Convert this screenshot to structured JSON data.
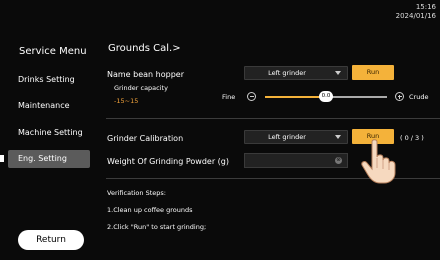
{
  "status": {
    "time": "15:16",
    "date": "2024/01/16"
  },
  "sidebar": {
    "title": "Service Menu",
    "items": [
      {
        "label": "Drinks Setting",
        "active": false
      },
      {
        "label": "Maintenance",
        "active": false
      },
      {
        "label": "Machine Setting",
        "active": false
      },
      {
        "label": "Eng. Setting",
        "active": true
      }
    ],
    "return_label": "Return"
  },
  "main": {
    "title": "Grounds Cal.>",
    "hopper": {
      "label": "Name bean hopper",
      "select_value": "Left grinder",
      "run_label": "Run"
    },
    "capacity": {
      "label": "Grinder capacity",
      "range": "-15~15",
      "min_label": "Fine",
      "max_label": "Crude",
      "value": "0.0",
      "fraction": 0.5
    },
    "calibration": {
      "label": "Grinder Calibration",
      "select_value": "Left grinder",
      "run_label": "Run",
      "progress": "( 0 / 3 )"
    },
    "weight": {
      "label": "Weight Of Grinding Powder (g)",
      "value": "",
      "placeholder": ""
    },
    "steps": {
      "title": "Verification Steps:",
      "items": [
        "1.Clean up coffee grounds",
        "2.Click \"Run\" to start grinding;"
      ]
    }
  },
  "colors": {
    "accent": "#f4b23a",
    "range_text": "#f0a13b",
    "background": "#0a0a0a",
    "active_item": "#5b5b5b"
  },
  "icons": [
    "dropdown-arrow-icon",
    "minus-icon",
    "plus-icon",
    "clear-icon",
    "pointer-hand-icon"
  ]
}
